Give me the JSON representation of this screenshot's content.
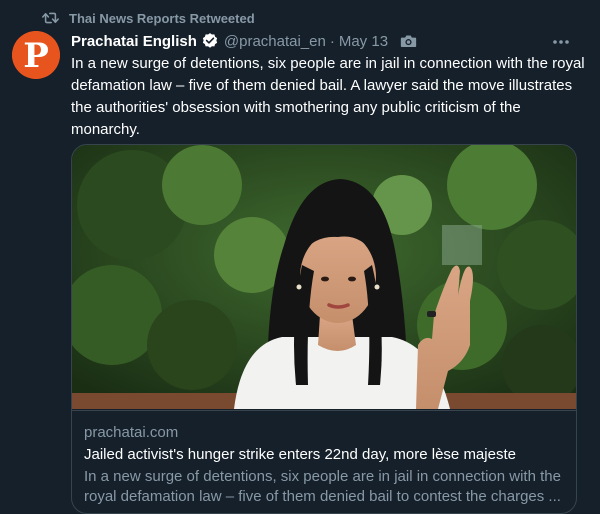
{
  "retweet": {
    "label": "Thai News Reports Retweeted"
  },
  "author": {
    "display_name": "Prachatai English",
    "handle": "@prachatai_en",
    "avatar_letter": "P",
    "avatar_color": "#e8541e"
  },
  "meta": {
    "separator": "·",
    "date": "May 13"
  },
  "tweet": {
    "text": "In a new surge of detentions, six people are in jail in connection with the royal defamation law – five of them denied bail. A lawyer said the move illustrates the authorities' obsession with smothering any public criticism of the monarchy."
  },
  "card": {
    "domain": "prachatai.com",
    "title": "Jailed activist's hunger strike enters 22nd day, more lèse majeste",
    "description": "In a new surge of detentions, six people are in jail in connection with the royal defamation law – five of them denied bail to contest the charges ..."
  },
  "icons": [
    "retweet-icon",
    "verified-badge-icon",
    "camera-icon",
    "more-options-icon"
  ],
  "colors": {
    "background": "#15202b",
    "text_primary": "#ffffff",
    "text_secondary": "#8899a6",
    "border": "#38444d",
    "verified": "#ffffff"
  }
}
